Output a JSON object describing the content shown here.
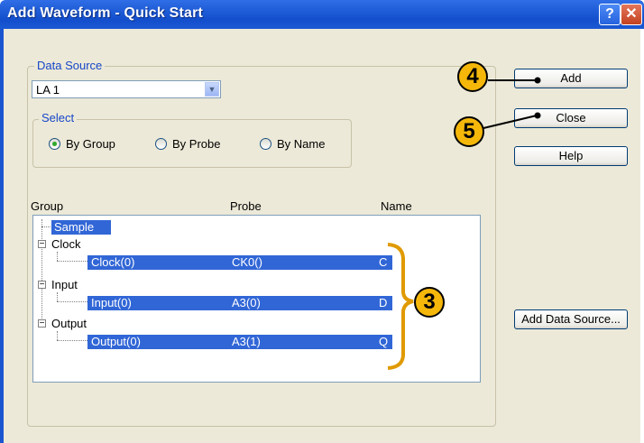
{
  "window": {
    "title": "Add Waveform - Quick Start",
    "help_glyph": "?",
    "close_glyph": "✕"
  },
  "data_source": {
    "legend": "Data Source",
    "selected": "LA 1",
    "select_legend": "Select",
    "options": [
      "By Group",
      "By Probe",
      "By Name"
    ],
    "checked": "By Group"
  },
  "table": {
    "headers": {
      "group": "Group",
      "probe": "Probe",
      "name": "Name"
    },
    "rows": [
      {
        "group": "Sample",
        "probe": "",
        "name": ""
      },
      {
        "group": "Clock",
        "probe": "",
        "name": ""
      },
      {
        "group": "Clock(0)",
        "probe": "CK0()",
        "name": "C"
      },
      {
        "group": "Input",
        "probe": "",
        "name": ""
      },
      {
        "group": "Input(0)",
        "probe": "A3(0)",
        "name": "D"
      },
      {
        "group": "Output",
        "probe": "",
        "name": ""
      },
      {
        "group": "Output(0)",
        "probe": "A3(1)",
        "name": "Q"
      }
    ]
  },
  "buttons": {
    "add": "Add",
    "close": "Close",
    "help": "Help",
    "add_data_source": "Add Data Source..."
  },
  "callouts": [
    "4",
    "5",
    "3"
  ],
  "colors": {
    "title_bar": "#1e5bd6",
    "selection": "#3166d6",
    "callout": "#f5b70a",
    "dialog_bg": "#ece9d8"
  }
}
